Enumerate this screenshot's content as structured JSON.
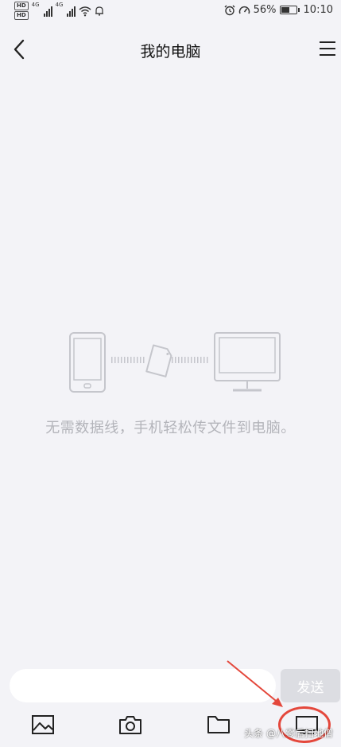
{
  "status_bar": {
    "hd_label": "HD",
    "network_label_1": "4G",
    "network_label_2": "4G",
    "battery_percent": "56%",
    "time": "10:10",
    "battery_level": 0.56
  },
  "nav": {
    "title": "我的电脑",
    "back_icon": "chevron-left-icon",
    "menu_icon": "hamburger-menu-icon"
  },
  "empty_state": {
    "message": "无需数据线，手机轻松传文件到电脑。",
    "icons": [
      "phone-icon",
      "file-icon",
      "monitor-icon"
    ]
  },
  "composer": {
    "input_value": "",
    "input_placeholder": "",
    "send_label": "发送"
  },
  "toolbar": {
    "items": [
      {
        "icon": "image-icon"
      },
      {
        "icon": "camera-icon"
      },
      {
        "icon": "folder-icon"
      },
      {
        "icon": "computer-icon"
      }
    ]
  },
  "annotation": {
    "color": "#e4473b"
  },
  "watermark": {
    "text": "头条 @八零后扫地僧"
  },
  "colors": {
    "background": "#f3f3f7",
    "muted_text": "#b3b4ba",
    "send_bg": "#dcdde2"
  }
}
